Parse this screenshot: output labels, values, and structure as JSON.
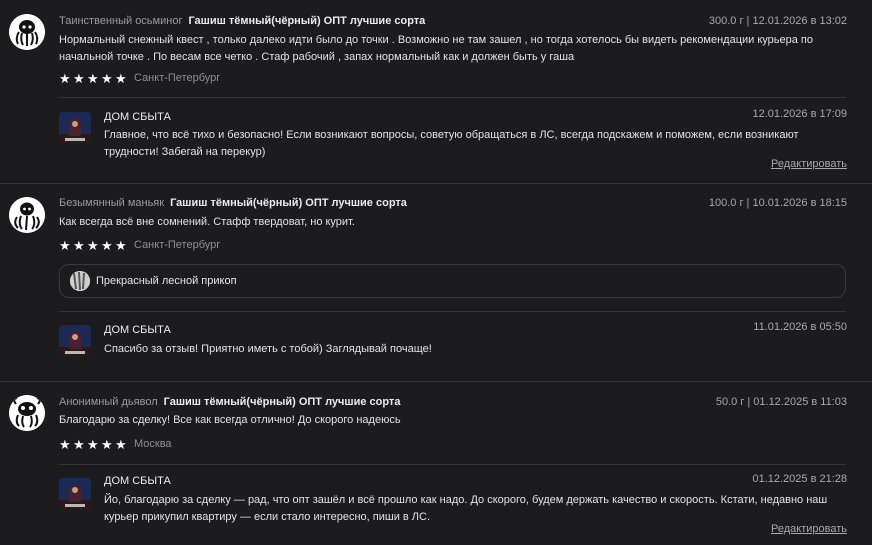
{
  "reviews": [
    {
      "author": "Таинственный осьминог",
      "product": "Гашиш тёмный(чёрный) ОПТ лучшие сорта",
      "meta": "300.0 г | 12.01.2026 в 13:02",
      "text": "Нормальный снежный квест , только далеко идти было до точки . Возможно не там зашел , но тогда хотелось бы видеть рекомендации курьера по начальной точке . По весам все четко . Стаф рабочий , запах нормальный как и должен быть у гаша",
      "rating": 5,
      "city": "Санкт-Петербург",
      "reply": {
        "name": "ДОМ СБЫТА",
        "date": "12.01.2026 в 17:09",
        "text": "Главное, что всё тихо и безопасно! Если возникают вопросы, советую обращаться в ЛС, всегда подскажем и поможем, если возникают трудности! Забегай на перекур)",
        "edit": "Редактировать"
      }
    },
    {
      "author": "Безымянный маньяк",
      "product": "Гашиш тёмный(чёрный) ОПТ лучшие сорта",
      "meta": "100.0 г | 10.01.2026 в 18:15",
      "text": "Как всегда всё вне сомнений. Стафф твердоват, но курит.",
      "rating": 5,
      "city": "Санкт-Петербург",
      "attachment": "Прекрасный лесной прикоп",
      "reply": {
        "name": "ДОМ СБЫТА",
        "date": "11.01.2026 в 05:50",
        "text": "Спасибо за отзыв! Приятно иметь с тобой) Заглядывай почаще!"
      }
    },
    {
      "author": "Анонимный дьявол",
      "product": "Гашиш тёмный(чёрный) ОПТ лучшие сорта",
      "meta": "50.0 г | 01.12.2025 в 11:03",
      "text": "Благодарю за сделку! Все как всегда отлично! До скорого надеюсь",
      "rating": 5,
      "city": "Москва",
      "reply": {
        "name": "ДОМ СБЫТА",
        "date": "01.12.2025 в 21:28",
        "text": "Йо, благодарю за сделку — рад, что опт зашёл и всё прошло как надо. До скорого, будем держать качество и скорость. Кстати, недавно наш курьер прикупил квартиру — если стало интересно, пиши в ЛС.",
        "edit": "Редактировать"
      }
    }
  ],
  "icons": {
    "avatar": "octopus-avatar-icon",
    "star": "star-icon",
    "shop_avatar": "shop-avatar-icon",
    "attachment": "photo-thumbnail-icon"
  },
  "colors": {
    "background": "#1c1c1e",
    "divider": "#333336",
    "text": "#e2e2e2",
    "muted": "#9a9a9a"
  }
}
